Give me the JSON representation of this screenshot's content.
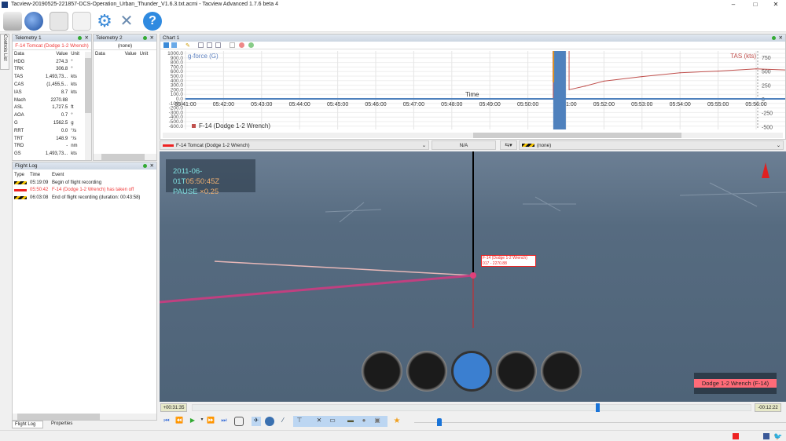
{
  "window": {
    "title": "Tacview-20190525-221857-DCS-Operation_Urban_Thunder_V1.6.3.txt.acmi - Tacview Advanced 1.7.6 beta 4"
  },
  "toolbar": {
    "icons": [
      "usb-drive-icon",
      "globe-icon",
      "document-icon",
      "edit-icon",
      "gear-icon",
      "tools-icon",
      "help-icon"
    ]
  },
  "side_tab": "Controls List",
  "telemetry1": {
    "title": "Telemetry 1",
    "object": "F-14 Tomcat (Dodge 1-2 Wrench)",
    "headers": [
      "Data",
      "Value",
      "Unit"
    ],
    "rows": [
      [
        "HDG",
        "274.3",
        "°"
      ],
      [
        "TRK",
        "306.8",
        "°"
      ],
      [
        "TAS",
        "1,493,73...",
        "kts"
      ],
      [
        "CAS",
        "(1,455,5...",
        "kts"
      ],
      [
        "IAS",
        "8.7",
        "kts"
      ],
      [
        "Mach",
        "2270.88",
        ""
      ],
      [
        "ASL",
        "1,727.5",
        "ft"
      ],
      [
        "AOA",
        "0.7",
        "°"
      ],
      [
        "G",
        "1562.5",
        "g"
      ],
      [
        "RRT",
        "0.0",
        "°/s"
      ],
      [
        "TRT",
        "148.9",
        "°/s"
      ],
      [
        "TRD",
        "-",
        "nm"
      ],
      [
        "GS",
        "1,493,73...",
        "kts"
      ]
    ]
  },
  "telemetry2": {
    "title": "Telemetry 2",
    "object": "(none)",
    "headers": [
      "Data",
      "Value",
      "Unit"
    ]
  },
  "flight_log": {
    "title": "Flight Log",
    "headers": [
      "Type",
      "Time",
      "Event"
    ],
    "rows": [
      {
        "time": "05:19:09",
        "event": "Begin of flight recording",
        "highlight": false
      },
      {
        "time": "05:50:42",
        "event": "F-14 (Dodge 1-2 Wrench) has taken off",
        "highlight": true
      },
      {
        "time": "06:03:08",
        "event": "End of flight recording (duration: 00:43:58)",
        "highlight": false
      }
    ]
  },
  "bottom_tabs": [
    "Flight Log",
    "Properties"
  ],
  "chart": {
    "title": "Chart 1",
    "left_label": "g-force (G)",
    "right_label": "TAS (kts)",
    "time_label": "Time",
    "legend": "F-14 (Dodge 1-2 Wrench)",
    "left_ticks": [
      "1000.0",
      "900.0",
      "800.0",
      "700.0",
      "600.0",
      "500.0",
      "400.0",
      "300.0",
      "200.0",
      "100.0",
      "0.0",
      "-100.0",
      "-200.0",
      "-300.0",
      "-400.0",
      "-500.0",
      "-600.0"
    ],
    "right_ticks": [
      "750",
      "500",
      "250",
      "0",
      "-250",
      "-500"
    ],
    "x_ticks": [
      "05:41:00",
      "05:42:00",
      "05:43:00",
      "05:44:00",
      "05:45:00",
      "05:46:00",
      "05:47:00",
      "05:48:00",
      "05:49:00",
      "05:50:00",
      "05:51:00",
      "05:52:00",
      "05:53:00",
      "05:54:00",
      "05:55:00",
      "05:56:00"
    ]
  },
  "chart_data": {
    "type": "line",
    "xlabel": "Time",
    "series": [
      {
        "name": "TAS (kts)",
        "axis": "right",
        "color": "#c0504d",
        "x": [
          "05:51:05",
          "05:51:30",
          "05:52:00",
          "05:53:00",
          "05:54:00",
          "05:55:00",
          "05:56:00",
          "05:56:50"
        ],
        "y": [
          165,
          230,
          320,
          400,
          470,
          500,
          540,
          520
        ]
      },
      {
        "name": "g-force (G)",
        "axis": "left",
        "color": "#4f81bd",
        "x": [
          "05:41:00",
          "05:50:40",
          "05:51:05",
          "05:56:50"
        ],
        "y": [
          0,
          0,
          0,
          0
        ]
      }
    ],
    "left_ylim": [
      -600,
      1000
    ],
    "right_ylim": [
      -600,
      800
    ]
  },
  "selector": {
    "primary": "F-14 Tomcat (Dodge 1-2 Wrench)",
    "distance": "N/A",
    "secondary": "(none)"
  },
  "view": {
    "date": "2011-06-01T",
    "time": "05:50:45Z",
    "status": "PAUSE",
    "speed": "×0.25",
    "label_line1": "F-14 (Dodge 1-2 Wrench)",
    "label_line2": "017 - 2270.88",
    "selected_label": "Dodge 1-2 Wrench (F-14)"
  },
  "timeline": {
    "elapsed": "+00:31:35",
    "remaining": "-00:12:22",
    "progress": 0.72
  },
  "colors": {
    "accent": "#3a6fd8",
    "highlight": "#ff4d5e",
    "tas": "#c0504d",
    "gforce": "#4f81bd"
  }
}
